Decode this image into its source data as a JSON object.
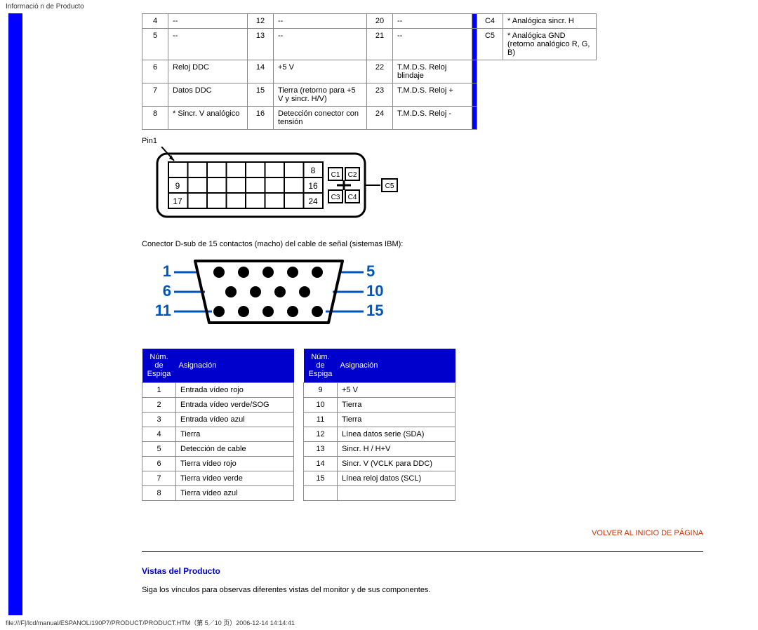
{
  "page_header": "Informació n de Producto",
  "dvi_table": {
    "col1": [
      {
        "pin": "4",
        "val": "--"
      },
      {
        "pin": "5",
        "val": "--"
      },
      {
        "pin": "6",
        "val": "Reloj DDC"
      },
      {
        "pin": "7",
        "val": "Datos DDC"
      },
      {
        "pin": "8",
        "val": "* Sincr. V analógico"
      }
    ],
    "col2": [
      {
        "pin": "12",
        "val": "--"
      },
      {
        "pin": "13",
        "val": "--"
      },
      {
        "pin": "14",
        "val": "+5 V"
      },
      {
        "pin": "15",
        "val": "Tierra (retorno para +5 V y sincr. H/V)"
      },
      {
        "pin": "16",
        "val": "Detección conector con tensión"
      }
    ],
    "col3": [
      {
        "pin": "20",
        "val": "--"
      },
      {
        "pin": "21",
        "val": "--"
      },
      {
        "pin": "22",
        "val": "T.M.D.S. Reloj blindaje"
      },
      {
        "pin": "23",
        "val": "T.M.D.S. Reloj +"
      },
      {
        "pin": "24",
        "val": "T.M.D.S. Reloj -"
      }
    ],
    "col4": [
      {
        "pin": "C4",
        "val": "* Analógica sincr. H"
      },
      {
        "pin": "C5",
        "val": "* Analógica GND (retorno analógico R, G, B)"
      }
    ]
  },
  "dvi_diagram": {
    "pin_label": "Pin1",
    "left_col": [
      "9",
      "17"
    ],
    "right_col": [
      "8",
      "16",
      "24"
    ],
    "box_labels": [
      "C1",
      "C2",
      "C3",
      "C4"
    ],
    "outer_box": "C5"
  },
  "dsub_caption": "Conector D-sub de 15 contactos (macho) del cable de señal (sistemas IBM):",
  "dsub_diagram": {
    "left_nums": [
      "1",
      "6",
      "11"
    ],
    "right_nums": [
      "5",
      "10",
      "15"
    ]
  },
  "assign_table": {
    "header_pin": "Núm. de Espiga",
    "header_assign": "Asignación",
    "left": [
      {
        "pin": "1",
        "val": "Entrada vídeo rojo"
      },
      {
        "pin": "2",
        "val": "Entrada vídeo verde/SOG"
      },
      {
        "pin": "3",
        "val": "Entrada vídeo azul"
      },
      {
        "pin": "4",
        "val": "Tierra"
      },
      {
        "pin": "5",
        "val": "Detección de cable"
      },
      {
        "pin": "6",
        "val": "Tierra vídeo rojo"
      },
      {
        "pin": "7",
        "val": "Tierra vídeo verde"
      },
      {
        "pin": "8",
        "val": "Tierra vídeo azul"
      }
    ],
    "right": [
      {
        "pin": "9",
        "val": "+5 V"
      },
      {
        "pin": "10",
        "val": "Tierra"
      },
      {
        "pin": "11",
        "val": "Tierra"
      },
      {
        "pin": "12",
        "val": "Línea datos serie (SDA)"
      },
      {
        "pin": "13",
        "val": "Sincr. H / H+V"
      },
      {
        "pin": "14",
        "val": "Sincr. V (VCLK para DDC)"
      },
      {
        "pin": "15",
        "val": "Línea reloj datos (SCL)"
      }
    ]
  },
  "linkback": "VOLVER AL INICIO DE PÁGINA",
  "section_title": "Vistas del Producto",
  "body_text": "Siga los vínculos para observas diferentes vistas del monitor y de sus componentes.",
  "footer_path": "file:///F|/lcd/manual/ESPANOL/190P7/PRODUCT/PRODUCT.HTM（第 5／10 页）2006-12-14 14:14:41"
}
